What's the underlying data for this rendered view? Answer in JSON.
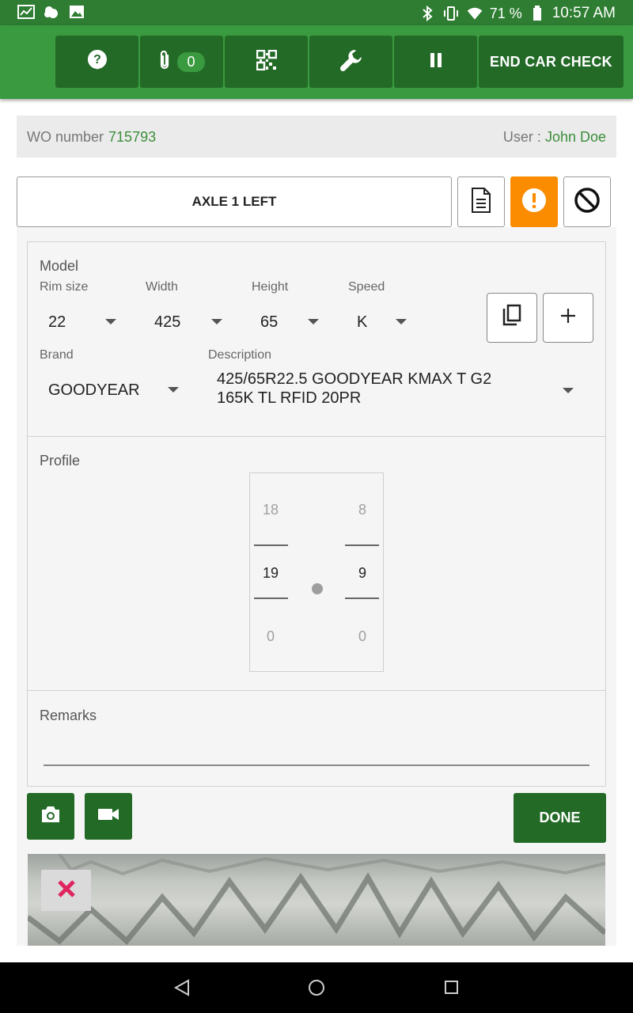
{
  "status_bar": {
    "battery": "71 %",
    "time": "10:57 AM",
    "left_icons": [
      "chart-notification-icon",
      "weather-icon",
      "image-notification-icon"
    ],
    "right_icons": [
      "bluetooth-icon",
      "vibrate-icon",
      "wifi-icon",
      "battery-icon"
    ]
  },
  "toolbar": {
    "attachments_count": "0",
    "end_label": "END CAR CHECK",
    "icons": [
      "help-icon",
      "paperclip-icon",
      "qr-code-icon",
      "wrench-icon",
      "pause-icon"
    ]
  },
  "work_order": {
    "label": "WO number",
    "value": "715793",
    "user_label": "User : ",
    "user_value": "John Doe"
  },
  "position": {
    "label": "AXLE 1 LEFT"
  },
  "model": {
    "title": "Model",
    "rim_label": "Rim size",
    "rim_value": "22",
    "width_label": "Width",
    "width_value": "425",
    "height_label": "Height",
    "height_value": "65",
    "speed_label": "Speed",
    "speed_value": "K",
    "brand_label": "Brand",
    "brand_value": "GOODYEAR",
    "description_label": "Description",
    "description_line1": "425/65R22.5 GOODYEAR KMAX T G2",
    "description_line2": "165K TL RFID 20PR"
  },
  "profile": {
    "title": "Profile",
    "left_prev": "18",
    "left_value": "19",
    "left_next": "0",
    "right_prev": "8",
    "right_value": "9",
    "right_next": "0"
  },
  "remarks": {
    "title": "Remarks",
    "value": ""
  },
  "actions": {
    "done_label": "DONE"
  },
  "colors": {
    "primary_green": "#3a9a3f",
    "dark_green": "#236a27",
    "accent_orange": "#fb8c00",
    "delete_red": "#e0245e"
  }
}
